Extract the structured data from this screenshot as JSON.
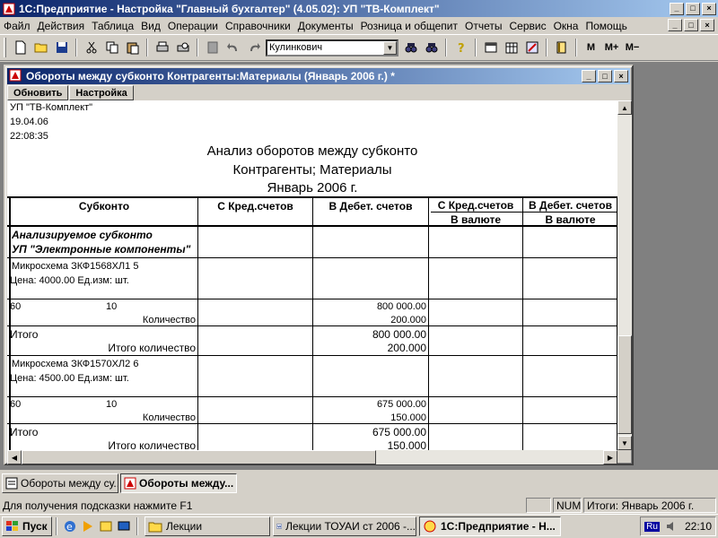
{
  "app": {
    "title": "1С:Предприятие - Настройка \"Главный бухгалтер\"  (4.05.02): УП \"ТВ-Комплект\"",
    "minimize": "_",
    "maximize": "□",
    "close": "×"
  },
  "menu": [
    "Файл",
    "Действия",
    "Таблица",
    "Вид",
    "Операции",
    "Справочники",
    "Документы",
    "Розница и общепит",
    "Отчеты",
    "Сервис",
    "Окна",
    "Помощь"
  ],
  "toolbar": {
    "user": "Кулинкович",
    "m": "M",
    "mplus": "M+",
    "mminus": "M−"
  },
  "window": {
    "title": "Обороты между субконто Контрагенты:Материалы (Январь 2006 г.)  *",
    "refresh": "Обновить",
    "settings": "Настройка"
  },
  "report": {
    "org": "УП \"ТВ-Комплект\"",
    "date": "19.04.06",
    "time": "22:08:35",
    "title1": "Анализ оборотов между субконто",
    "title2": "Контрагенты; Материалы",
    "title3": "Январь 2006 г.",
    "columns": {
      "subkonto": "Субконто",
      "cr_accounts": "С Кред.счетов",
      "db_accounts": "В Дебет. счетов",
      "cr_accounts_cur": "С Кред.счетов",
      "db_accounts_cur": "В Дебет. счетов",
      "currency": "В валюте",
      "currency2": "В валюте"
    },
    "section": {
      "line1": "Анализируемое субконто",
      "line2": "УП \"Электронные компоненты\""
    },
    "items": [
      {
        "name": "Микросхема ЗКФ1568ХЛ1 5",
        "price": "Цена: 4000.00 Ед.изм: шт.",
        "acct": "60",
        "subacct": "10",
        "qty_label": "Количество",
        "amount": "800 000.00",
        "qty": "200.000",
        "total_label": "Итого",
        "total_qty_label": "Итого количество",
        "total_amount": "800 000.00",
        "total_qty": "200.000"
      },
      {
        "name": "Микросхема ЗКФ1570ХЛ2 6",
        "price": "Цена: 4500.00 Ед.изм: шт.",
        "acct": "60",
        "subacct": "10",
        "qty_label": "Количество",
        "amount": "675 000.00",
        "qty": "150.000",
        "total_label": "Итого",
        "total_qty_label": "Итого количество",
        "total_amount": "675 000.00",
        "total_qty": "150.000"
      }
    ]
  },
  "window_tabs": [
    "Обороты между су...",
    "Обороты между..."
  ],
  "status": {
    "hint": "Для получения подсказки нажмите F1",
    "num": "NUM",
    "totals": "Итоги: Январь 2006 г."
  },
  "taskbar": {
    "start": "Пуск",
    "items": [
      "Лекции",
      "Лекции ТОУАИ ст 2006 -...",
      "1С:Предприятие - Н..."
    ],
    "lang": "Ru",
    "clock": "22:10"
  }
}
